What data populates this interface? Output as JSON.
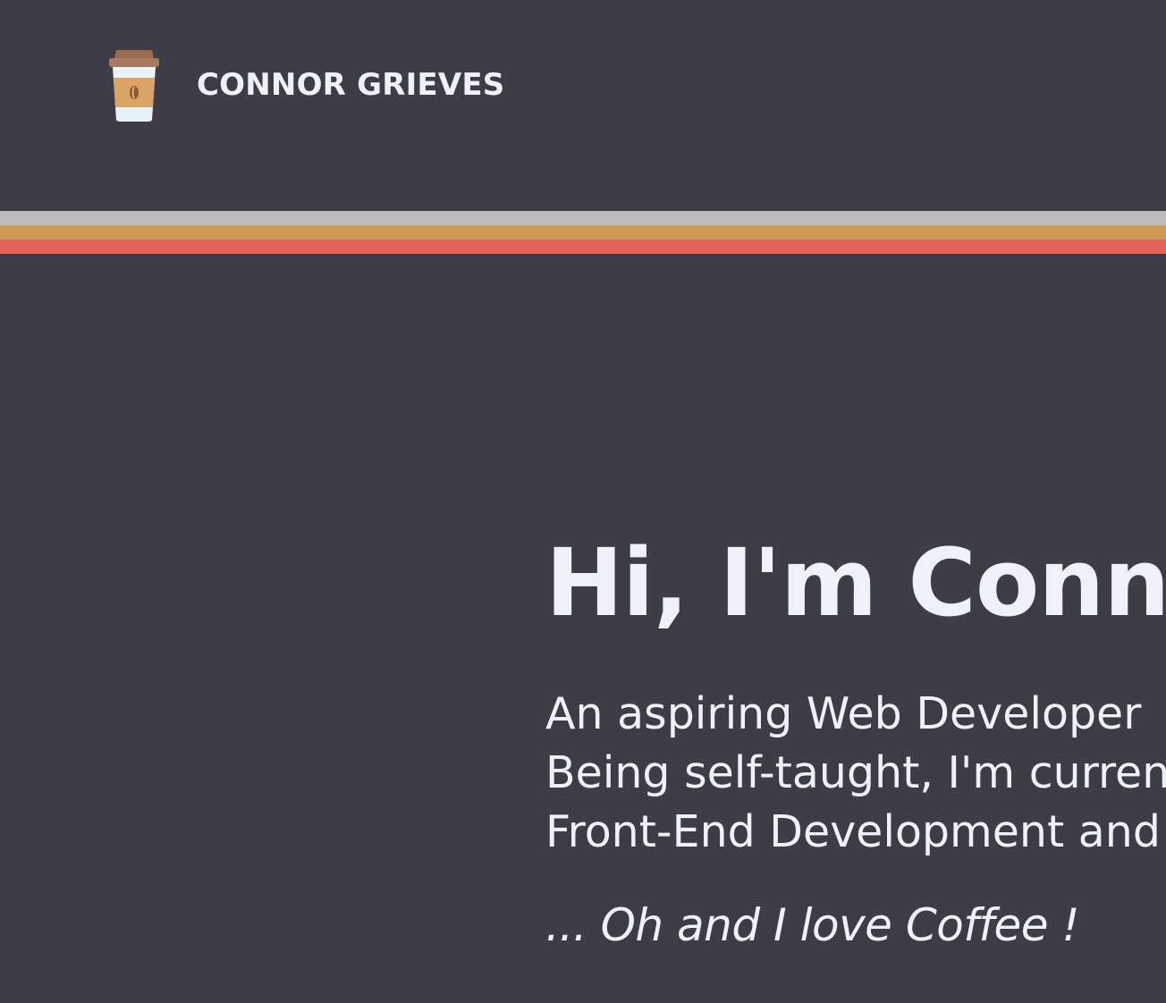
{
  "header": {
    "brand_name": "CONNOR GRIEVES",
    "logo_icon": "coffee-cup-icon"
  },
  "divider": {
    "colors": [
      "#bdbbbe",
      "#cf9a58",
      "#e4625a"
    ]
  },
  "hero": {
    "title": "Hi, I'm Conno",
    "intro_lines": [
      "An aspiring Web Developer",
      "Being self-taught, I'm curren",
      "Front-End Development and"
    ],
    "tagline": "... Oh and I love Coffee !"
  },
  "theme": {
    "background": "#3d3c47",
    "text": "#eef0fb"
  }
}
